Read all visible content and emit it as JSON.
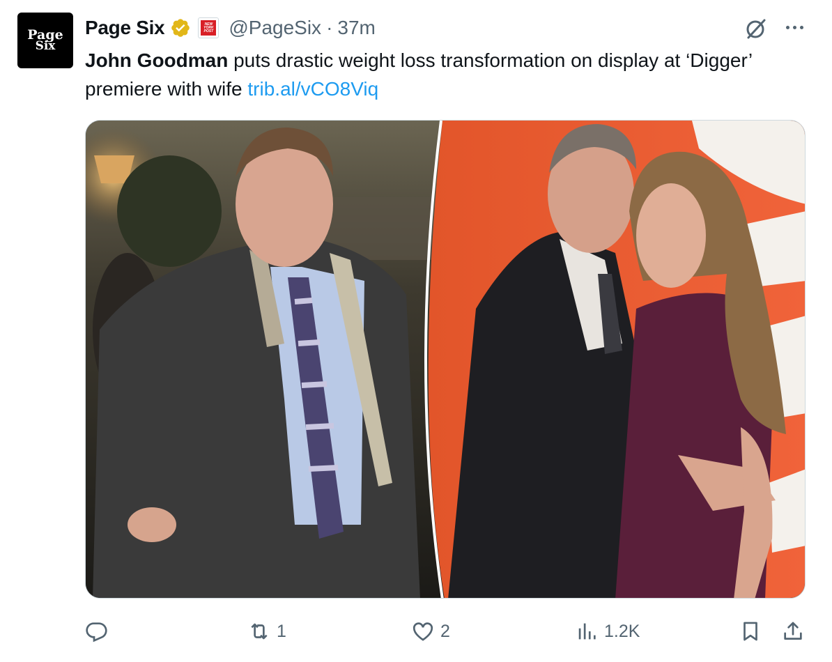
{
  "account": {
    "display_name": "Page Six",
    "handle": "@PageSix",
    "separator": "·",
    "time": "37m",
    "avatar_text_line1": "Page",
    "avatar_text_line2": "Six",
    "affiliate_text_1": "NEW",
    "affiliate_text_2": "YORK",
    "affiliate_text_3": "POST",
    "verified_color": "#e2b719"
  },
  "tweet": {
    "text_bold": "John Goodman",
    "text_rest": " puts drastic weight loss transformation on display at ‘Digger’ premiere with wife ",
    "link": "trib.al/vCO8Viq",
    "link_color": "#1d9bf0"
  },
  "actions": {
    "reply_count": "",
    "retweet_count": "1",
    "like_count": "2",
    "views_count": "1.2K"
  },
  "icons": [
    "grok-icon",
    "more-icon",
    "reply-icon",
    "retweet-icon",
    "like-icon",
    "views-icon",
    "bookmark-icon",
    "share-icon"
  ]
}
